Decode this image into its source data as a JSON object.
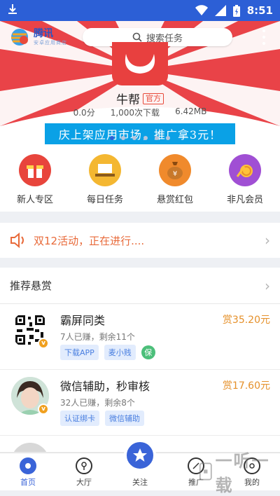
{
  "status_bar": {
    "time": "8:51"
  },
  "header": {
    "logo_title": "腾讯",
    "logo_subtitle": "安卓应用商店",
    "search_placeholder": "搜索任务"
  },
  "featured_app": {
    "name": "牛帮",
    "badge": "官方",
    "rating": "0.0分",
    "downloads": "1,000次下载",
    "size": "6.42MB",
    "promo_text": "庆上架应用市场，推广拿3元！"
  },
  "features": [
    {
      "label": "新人专区",
      "icon": "gift-icon",
      "color": "#e8453c"
    },
    {
      "label": "每日任务",
      "icon": "laptop-icon",
      "color": "#f4b731"
    },
    {
      "label": "悬赏红包",
      "icon": "money-bag-icon",
      "color": "#f08a2c"
    },
    {
      "label": "非凡会员",
      "icon": "vip-coin-icon",
      "color": "#a04fd4"
    }
  ],
  "notice": {
    "text": "双12活动，正在进行...."
  },
  "section": {
    "title": "推荐悬赏"
  },
  "tasks": [
    {
      "title": "霸屏同类",
      "meta": "7人已赚，剩余11个",
      "tags": [
        "下载APP",
        "麦小贱"
      ],
      "guarantee": "保",
      "reward": "赏35.20元"
    },
    {
      "title": "微信辅助，秒审核",
      "meta": "32人已赚，剩余8个",
      "tags": [
        "认证绑卡",
        "微信辅助"
      ],
      "reward": "赏17.60元"
    }
  ],
  "bottom_nav": [
    {
      "label": "首页",
      "active": true
    },
    {
      "label": "大厅"
    },
    {
      "label": "关注"
    },
    {
      "label": "推广"
    },
    {
      "label": "我的"
    }
  ],
  "watermark": "一听一载",
  "colors": {
    "primary": "#3a64d8",
    "reward": "#e5902a",
    "notice": "#e86a3a"
  }
}
